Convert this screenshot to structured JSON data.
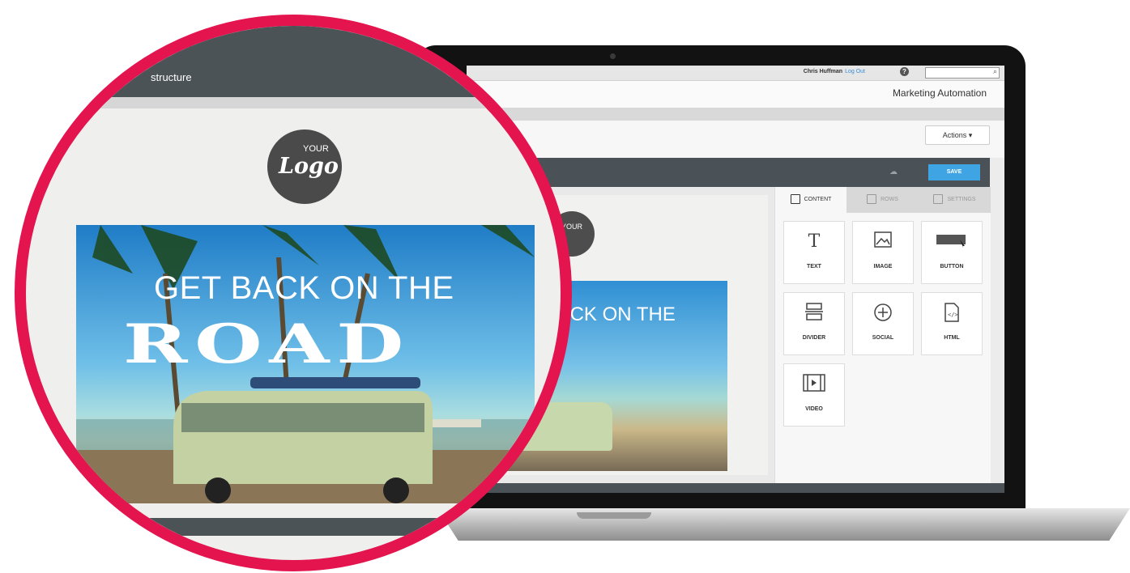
{
  "topbar": {
    "user_name": "Chris Huffman",
    "logout_label": "Log Out",
    "help_label": "?"
  },
  "header": {
    "app_title": "Marketing Automation"
  },
  "toolbar": {
    "actions_label": "Actions ▾",
    "save_label": "SAVE"
  },
  "sidebar": {
    "tabs": [
      {
        "label": "CONTENT",
        "icon": "grid-icon",
        "active": true
      },
      {
        "label": "ROWS",
        "icon": "rows-icon",
        "active": false
      },
      {
        "label": "SETTINGS",
        "icon": "settings-icon",
        "active": false
      }
    ],
    "blocks": [
      {
        "label": "TEXT",
        "icon": "text-icon"
      },
      {
        "label": "IMAGE",
        "icon": "image-icon"
      },
      {
        "label": "BUTTON",
        "icon": "button-icon"
      },
      {
        "label": "DIVIDER",
        "icon": "divider-icon"
      },
      {
        "label": "SOCIAL",
        "icon": "social-icon"
      },
      {
        "label": "HTML",
        "icon": "html-icon"
      },
      {
        "label": "VIDEO",
        "icon": "video-icon"
      }
    ]
  },
  "email": {
    "logo_small": "YOUR",
    "logo_script": "Logo",
    "hero_line1": "GET BACK ON THE",
    "hero_line2": "ROAD"
  },
  "magnifier": {
    "header_title": "structure"
  },
  "colors": {
    "accent": "#e3144e",
    "save": "#3ea4e4",
    "dark_bar": "#4b5357"
  }
}
